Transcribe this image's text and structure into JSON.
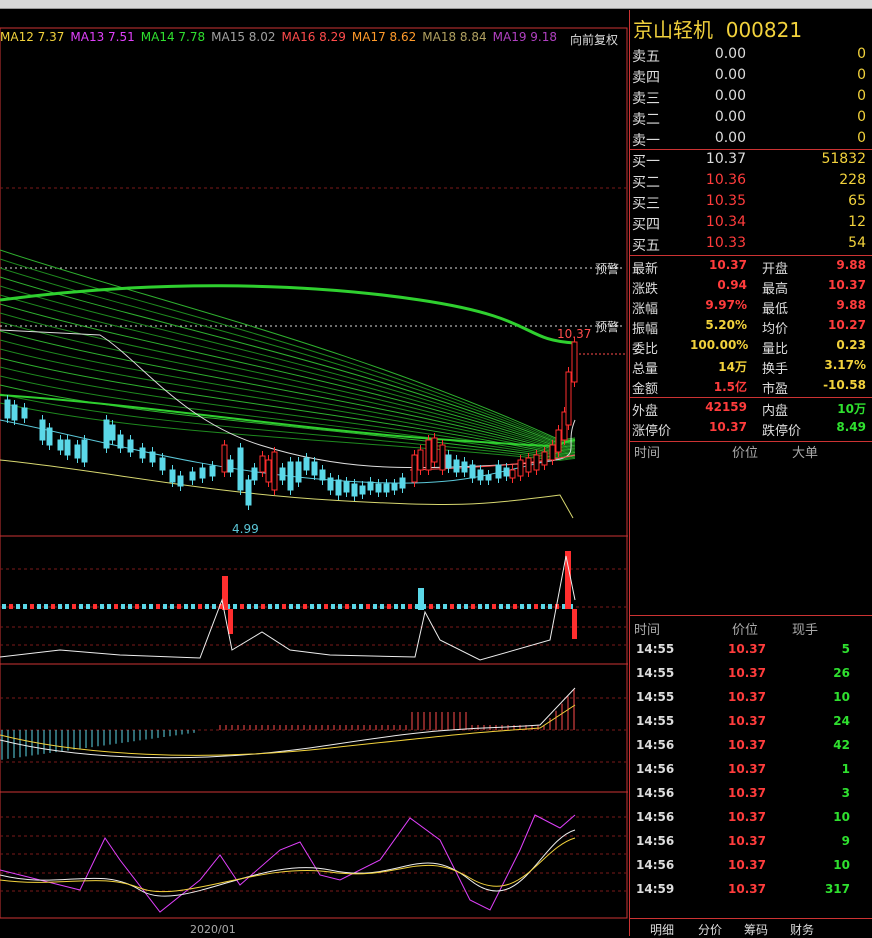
{
  "ma_legend": [
    {
      "label": "MA12 7.37",
      "color": "#f2d23c"
    },
    {
      "label": "MA13 7.51",
      "color": "#e040fb"
    },
    {
      "label": "MA14 7.78",
      "color": "#2fe02f"
    },
    {
      "label": "MA15 8.02",
      "color": "#a0a0a0"
    },
    {
      "label": "MA16 8.29",
      "color": "#ff4c4c"
    },
    {
      "label": "MA17 8.62",
      "color": "#ff9a2a"
    },
    {
      "label": "MA18 8.84",
      "color": "#b0a060"
    },
    {
      "label": "MA19 9.18",
      "color": "#b040c0"
    }
  ],
  "restore_label": "向前复权",
  "warn_label": "预警",
  "low_label": "4.99",
  "high_label": "10.37",
  "date_label": "2020/01",
  "stock": {
    "name": "京山轻机",
    "code": "000821"
  },
  "sell": [
    {
      "label": "卖五",
      "price": "0.00",
      "vol": "0"
    },
    {
      "label": "卖四",
      "price": "0.00",
      "vol": "0"
    },
    {
      "label": "卖三",
      "price": "0.00",
      "vol": "0"
    },
    {
      "label": "卖二",
      "price": "0.00",
      "vol": "0"
    },
    {
      "label": "卖一",
      "price": "0.00",
      "vol": "0"
    }
  ],
  "buy": [
    {
      "label": "买一",
      "price": "10.37",
      "vol": "51832",
      "pcolor": "#ddd"
    },
    {
      "label": "买二",
      "price": "10.36",
      "vol": "228",
      "pcolor": "#ff3c3c"
    },
    {
      "label": "买三",
      "price": "10.35",
      "vol": "65",
      "pcolor": "#ff3c3c"
    },
    {
      "label": "买四",
      "price": "10.34",
      "vol": "12",
      "pcolor": "#ff3c3c"
    },
    {
      "label": "买五",
      "price": "10.33",
      "vol": "54",
      "pcolor": "#ff3c3c"
    }
  ],
  "info": [
    {
      "l1": "最新",
      "v1": "10.37",
      "c1": "#ff3c3c",
      "l2": "开盘",
      "v2": "9.88",
      "c2": "#ff3c3c"
    },
    {
      "l1": "涨跌",
      "v1": "0.94",
      "c1": "#ff3c3c",
      "l2": "最高",
      "v2": "10.37",
      "c2": "#ff3c3c"
    },
    {
      "l1": "涨幅",
      "v1": "9.97%",
      "c1": "#ff3c3c",
      "l2": "最低",
      "v2": "9.88",
      "c2": "#ff3c3c"
    },
    {
      "l1": "振幅",
      "v1": "5.20%",
      "c1": "#f2d23c",
      "l2": "均价",
      "v2": "10.27",
      "c2": "#ff3c3c"
    },
    {
      "l1": "委比",
      "v1": "100.00%",
      "c1": "#f2d23c",
      "l2": "量比",
      "v2": "0.23",
      "c2": "#f2d23c"
    },
    {
      "l1": "总量",
      "v1": "14万",
      "c1": "#f2d23c",
      "l2": "换手",
      "v2": "3.17%",
      "c2": "#f2d23c"
    },
    {
      "l1": "金额",
      "v1": "1.5亿",
      "c1": "#ff3c3c",
      "l2": "市盈",
      "v2": "-10.58",
      "c2": "#f2d23c"
    }
  ],
  "info2": [
    {
      "l1": "外盘",
      "v1": "42159",
      "c1": "#ff3c3c",
      "l2": "内盘",
      "v2": "10万",
      "c2": "#2fe02f"
    },
    {
      "l1": "涨停价",
      "v1": "10.37",
      "c1": "#ff3c3c",
      "l2": "跌停价",
      "v2": "8.49",
      "c2": "#2fe02f"
    }
  ],
  "bigorder_header": {
    "time": "时间",
    "price": "价位",
    "big": "大单"
  },
  "trades_header": {
    "time": "时间",
    "price": "价位",
    "qty": "现手"
  },
  "trades": [
    {
      "time": "14:55",
      "price": "10.37",
      "qty": "5"
    },
    {
      "time": "14:55",
      "price": "10.37",
      "qty": "26"
    },
    {
      "time": "14:55",
      "price": "10.37",
      "qty": "10"
    },
    {
      "time": "14:55",
      "price": "10.37",
      "qty": "24"
    },
    {
      "time": "14:56",
      "price": "10.37",
      "qty": "42"
    },
    {
      "time": "14:56",
      "price": "10.37",
      "qty": "1"
    },
    {
      "time": "14:56",
      "price": "10.37",
      "qty": "3"
    },
    {
      "time": "14:56",
      "price": "10.37",
      "qty": "10"
    },
    {
      "time": "14:56",
      "price": "10.37",
      "qty": "9"
    },
    {
      "time": "14:56",
      "price": "10.37",
      "qty": "10"
    },
    {
      "time": "14:59",
      "price": "10.37",
      "qty": "317"
    }
  ],
  "tabs": [
    "明细",
    "分价",
    "筹码",
    "财务"
  ]
}
